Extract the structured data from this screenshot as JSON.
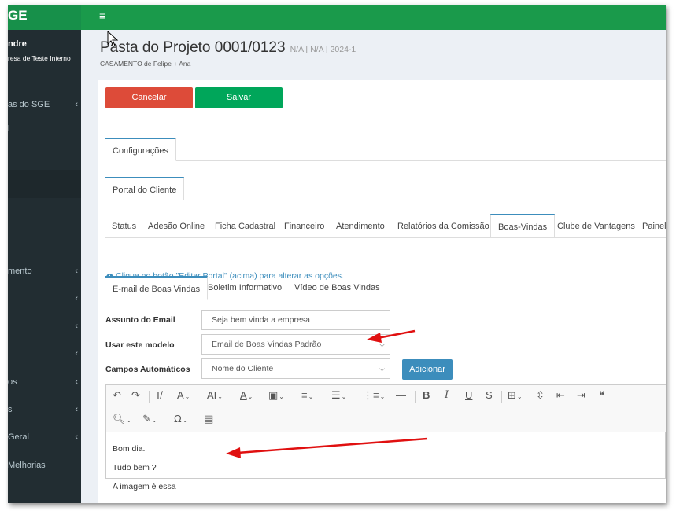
{
  "header": {
    "brand": "GE",
    "menu_icon": "hamburger-icon"
  },
  "sidebar": {
    "user_name": "ndre",
    "user_company": "resa de Teste Interno",
    "items": [
      {
        "label": "as do SGE",
        "chevron": "‹"
      },
      {
        "label": "l",
        "chevron": ""
      },
      {
        "label": "mento",
        "chevron": "‹"
      },
      {
        "label": "",
        "chevron": "‹"
      },
      {
        "label": "",
        "chevron": "‹"
      },
      {
        "label": "",
        "chevron": "‹"
      },
      {
        "label": "os",
        "chevron": "‹"
      },
      {
        "label": "s",
        "chevron": "‹"
      },
      {
        "label": "Geral",
        "chevron": "‹"
      },
      {
        "label": "Melhorias",
        "chevron": ""
      }
    ]
  },
  "page": {
    "title": "Pasta do Projeto 0001/0123",
    "meta": "N/A | N/A | 2024-1",
    "subtitle": "CASAMENTO de Felipe + Ana"
  },
  "actions": {
    "cancel": "Cancelar",
    "save": "Salvar"
  },
  "tabs_level1": [
    "Configurações"
  ],
  "tabs_level2": [
    "Portal do Cliente"
  ],
  "tabs_level3": [
    "Status",
    "Adesão Online",
    "Ficha Cadastral",
    "Financeiro",
    "Atendimento",
    "Relatórios da Comissão",
    "Boas-Vindas",
    "Clube de Vantagens",
    "Painel"
  ],
  "info_text": "Clique no botão \"Editar Portal\" (acima) para alterar as opções.",
  "tabs_level4": [
    "E-mail de Boas Vindas",
    "Boletim Informativo",
    "Vídeo de Boas Vindas"
  ],
  "form": {
    "subject_label": "Assunto do Email",
    "subject_value": "Seja bem vinda a empresa",
    "template_label": "Usar este modelo",
    "template_value": "Email de Boas Vindas Padrão",
    "fields_label": "Campos Automáticos",
    "fields_value": "Nome do Cliente",
    "add_button": "Adicionar"
  },
  "editor": {
    "lines": [
      "Bom dia.",
      "Tudo bem ?",
      "A imagem é essa"
    ]
  },
  "colors": {
    "green": "#1a9a4b",
    "red": "#dd4b39",
    "save": "#00a65a",
    "blue": "#3c8dbc",
    "sidebar": "#222d32"
  }
}
